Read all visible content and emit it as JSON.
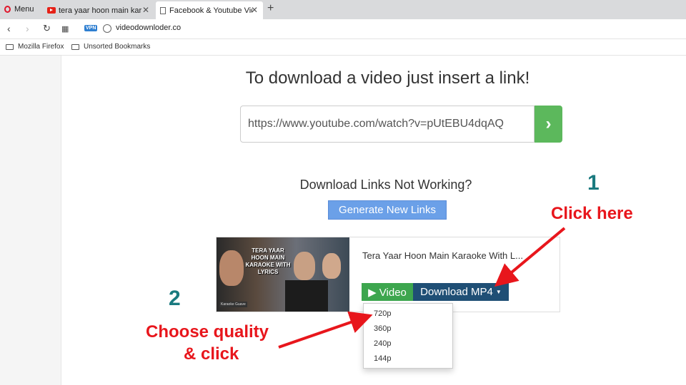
{
  "browser": {
    "menu_label": "Menu",
    "tabs": [
      {
        "title": "tera yaar hoon main karaoke",
        "icon": "youtube-icon"
      },
      {
        "title": "Facebook & Youtube Video",
        "icon": "document-icon"
      }
    ],
    "new_tab": "+",
    "close_glyph": "✕",
    "vpn_label": "VPN",
    "url": "videodownloder.co",
    "bookmarks": [
      "Mozilla Firefox",
      "Unsorted Bookmarks"
    ]
  },
  "page": {
    "headline": "To download a video just insert a link!",
    "input_value": "https://www.youtube.com/watch?v=pUtEBU4dqAQ",
    "go_glyph": "›",
    "not_working": "Download Links Not Working?",
    "generate_label": "Generate New Links",
    "video_title": "Tera Yaar Hoon Main Karaoke With L...",
    "thumb_text": "TERA YAAR HOON MAIN KARAOKE WITH LYRICS",
    "thumb_tag": "Karaoke Guave",
    "video_label": "▶ Video",
    "download_label": "Download MP4",
    "caret": "▼",
    "qualities": [
      "720p",
      "360p",
      "240p",
      "144p"
    ]
  },
  "annotations": {
    "step1": "1",
    "step1_text": "Click here",
    "step2": "2",
    "step2_line1": "Choose quality",
    "step2_line2": "& click"
  },
  "colors": {
    "go_button": "#5cb85c",
    "generate_button": "#6ba0e8",
    "video_tag": "#3da64e",
    "download_button": "#1f4f75",
    "annotation_red": "#e8161c",
    "annotation_number": "#1a7a7f"
  }
}
